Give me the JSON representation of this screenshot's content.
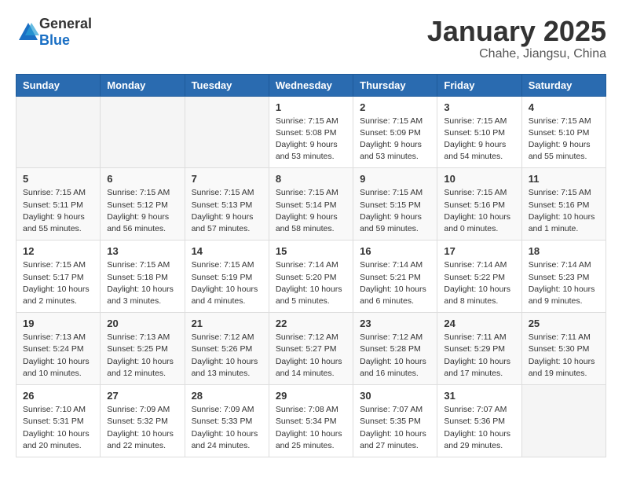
{
  "header": {
    "logo_general": "General",
    "logo_blue": "Blue",
    "month_year": "January 2025",
    "location": "Chahe, Jiangsu, China"
  },
  "weekdays": [
    "Sunday",
    "Monday",
    "Tuesday",
    "Wednesday",
    "Thursday",
    "Friday",
    "Saturday"
  ],
  "weeks": [
    [
      {
        "day": "",
        "info": ""
      },
      {
        "day": "",
        "info": ""
      },
      {
        "day": "",
        "info": ""
      },
      {
        "day": "1",
        "info": "Sunrise: 7:15 AM\nSunset: 5:08 PM\nDaylight: 9 hours and 53 minutes."
      },
      {
        "day": "2",
        "info": "Sunrise: 7:15 AM\nSunset: 5:09 PM\nDaylight: 9 hours and 53 minutes."
      },
      {
        "day": "3",
        "info": "Sunrise: 7:15 AM\nSunset: 5:10 PM\nDaylight: 9 hours and 54 minutes."
      },
      {
        "day": "4",
        "info": "Sunrise: 7:15 AM\nSunset: 5:10 PM\nDaylight: 9 hours and 55 minutes."
      }
    ],
    [
      {
        "day": "5",
        "info": "Sunrise: 7:15 AM\nSunset: 5:11 PM\nDaylight: 9 hours and 55 minutes."
      },
      {
        "day": "6",
        "info": "Sunrise: 7:15 AM\nSunset: 5:12 PM\nDaylight: 9 hours and 56 minutes."
      },
      {
        "day": "7",
        "info": "Sunrise: 7:15 AM\nSunset: 5:13 PM\nDaylight: 9 hours and 57 minutes."
      },
      {
        "day": "8",
        "info": "Sunrise: 7:15 AM\nSunset: 5:14 PM\nDaylight: 9 hours and 58 minutes."
      },
      {
        "day": "9",
        "info": "Sunrise: 7:15 AM\nSunset: 5:15 PM\nDaylight: 9 hours and 59 minutes."
      },
      {
        "day": "10",
        "info": "Sunrise: 7:15 AM\nSunset: 5:16 PM\nDaylight: 10 hours and 0 minutes."
      },
      {
        "day": "11",
        "info": "Sunrise: 7:15 AM\nSunset: 5:16 PM\nDaylight: 10 hours and 1 minute."
      }
    ],
    [
      {
        "day": "12",
        "info": "Sunrise: 7:15 AM\nSunset: 5:17 PM\nDaylight: 10 hours and 2 minutes."
      },
      {
        "day": "13",
        "info": "Sunrise: 7:15 AM\nSunset: 5:18 PM\nDaylight: 10 hours and 3 minutes."
      },
      {
        "day": "14",
        "info": "Sunrise: 7:15 AM\nSunset: 5:19 PM\nDaylight: 10 hours and 4 minutes."
      },
      {
        "day": "15",
        "info": "Sunrise: 7:14 AM\nSunset: 5:20 PM\nDaylight: 10 hours and 5 minutes."
      },
      {
        "day": "16",
        "info": "Sunrise: 7:14 AM\nSunset: 5:21 PM\nDaylight: 10 hours and 6 minutes."
      },
      {
        "day": "17",
        "info": "Sunrise: 7:14 AM\nSunset: 5:22 PM\nDaylight: 10 hours and 8 minutes."
      },
      {
        "day": "18",
        "info": "Sunrise: 7:14 AM\nSunset: 5:23 PM\nDaylight: 10 hours and 9 minutes."
      }
    ],
    [
      {
        "day": "19",
        "info": "Sunrise: 7:13 AM\nSunset: 5:24 PM\nDaylight: 10 hours and 10 minutes."
      },
      {
        "day": "20",
        "info": "Sunrise: 7:13 AM\nSunset: 5:25 PM\nDaylight: 10 hours and 12 minutes."
      },
      {
        "day": "21",
        "info": "Sunrise: 7:12 AM\nSunset: 5:26 PM\nDaylight: 10 hours and 13 minutes."
      },
      {
        "day": "22",
        "info": "Sunrise: 7:12 AM\nSunset: 5:27 PM\nDaylight: 10 hours and 14 minutes."
      },
      {
        "day": "23",
        "info": "Sunrise: 7:12 AM\nSunset: 5:28 PM\nDaylight: 10 hours and 16 minutes."
      },
      {
        "day": "24",
        "info": "Sunrise: 7:11 AM\nSunset: 5:29 PM\nDaylight: 10 hours and 17 minutes."
      },
      {
        "day": "25",
        "info": "Sunrise: 7:11 AM\nSunset: 5:30 PM\nDaylight: 10 hours and 19 minutes."
      }
    ],
    [
      {
        "day": "26",
        "info": "Sunrise: 7:10 AM\nSunset: 5:31 PM\nDaylight: 10 hours and 20 minutes."
      },
      {
        "day": "27",
        "info": "Sunrise: 7:09 AM\nSunset: 5:32 PM\nDaylight: 10 hours and 22 minutes."
      },
      {
        "day": "28",
        "info": "Sunrise: 7:09 AM\nSunset: 5:33 PM\nDaylight: 10 hours and 24 minutes."
      },
      {
        "day": "29",
        "info": "Sunrise: 7:08 AM\nSunset: 5:34 PM\nDaylight: 10 hours and 25 minutes."
      },
      {
        "day": "30",
        "info": "Sunrise: 7:07 AM\nSunset: 5:35 PM\nDaylight: 10 hours and 27 minutes."
      },
      {
        "day": "31",
        "info": "Sunrise: 7:07 AM\nSunset: 5:36 PM\nDaylight: 10 hours and 29 minutes."
      },
      {
        "day": "",
        "info": ""
      }
    ]
  ]
}
